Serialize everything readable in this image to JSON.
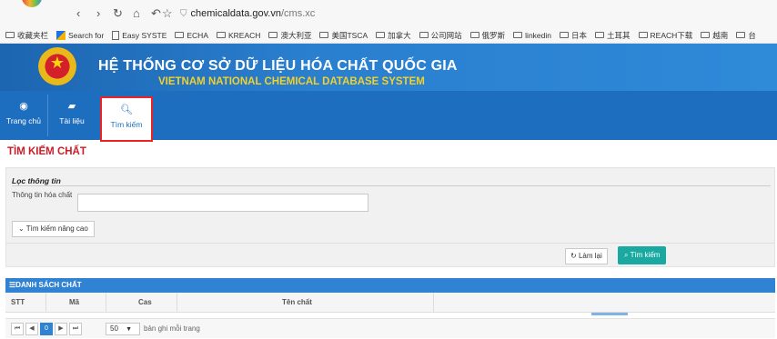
{
  "browser": {
    "url_domain": "chemicaldata.gov.vn",
    "url_path": "/cms.xc",
    "bookmarks": [
      "收藏夹栏",
      "Search for",
      "Easy SYSTE",
      "ECHA",
      "KREACH",
      "澳大利亚",
      "美国TSCA",
      "加拿大",
      "公司网站",
      "俄罗斯",
      "linkedin",
      "日本",
      "土耳其",
      "REACH下载",
      "越南",
      "台"
    ]
  },
  "header": {
    "title_vn": "HỆ THỐNG CƠ SỞ DỮ LIỆU HÓA CHẤT QUỐC GIA",
    "title_en": "VIETNAM NATIONAL CHEMICAL DATABASE SYSTEM"
  },
  "nav": {
    "items": [
      {
        "label": "Trang chủ",
        "icon": "dashboard-icon"
      },
      {
        "label": "Tài liệu",
        "icon": "book-icon"
      },
      {
        "label": "Tìm kiếm",
        "icon": "search-icon",
        "active": true
      }
    ]
  },
  "page": {
    "title": "TÌM KIẾM CHẤT"
  },
  "filter": {
    "heading": "Lọc thông tin",
    "field_label": "Thông tin hóa chất",
    "field_value": "",
    "advanced_label": "Tìm kiếm nâng cao",
    "reset_label": "Làm lại",
    "search_label": "Tìm kiếm"
  },
  "list": {
    "heading": "DANH SÁCH CHẤT",
    "columns": [
      "STT",
      "Mã",
      "Cas",
      "Tên chất"
    ]
  },
  "pager": {
    "current_page": "0",
    "per_page": "50",
    "per_page_label": "bản ghi mỗi trang"
  },
  "colors": {
    "nav": "#1e6ec0",
    "accent_red": "#c8202a",
    "search_btn": "#19a9a0"
  }
}
